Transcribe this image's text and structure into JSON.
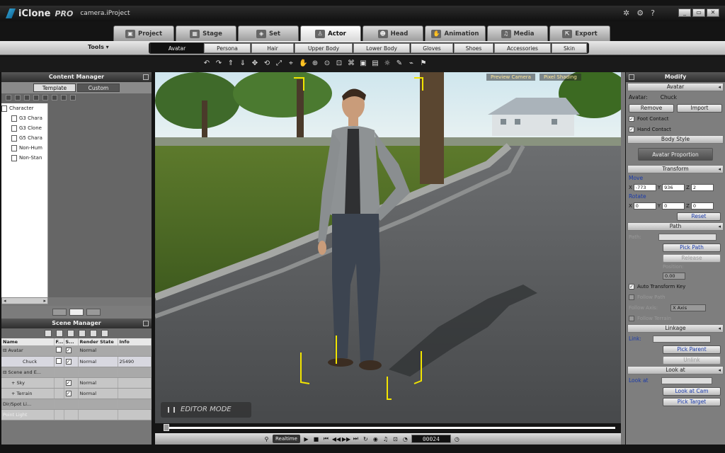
{
  "app": {
    "brand": "iClone",
    "edition": "PRO",
    "project": "camera.iProject"
  },
  "window_controls": [
    "_",
    "▭",
    "✕"
  ],
  "title_icons": {
    "puzzle": "✲",
    "gear": "⚙",
    "help": "?"
  },
  "main_tabs": [
    {
      "label": "Project",
      "icon": "▣"
    },
    {
      "label": "Stage",
      "icon": "▦"
    },
    {
      "label": "Set",
      "icon": "◈"
    },
    {
      "label": "Actor",
      "icon": "♙"
    },
    {
      "label": "Head",
      "icon": "☻"
    },
    {
      "label": "Animation",
      "icon": "✋"
    },
    {
      "label": "Media",
      "icon": "♫"
    },
    {
      "label": "Export",
      "icon": "⇱"
    }
  ],
  "active_main_tab": "Actor",
  "tools_label": "Tools ▾",
  "sub_tabs": [
    "Avatar",
    "Persona",
    "Hair",
    "Upper Body",
    "Lower Body",
    "Gloves",
    "Shoes",
    "Accessories",
    "Skin"
  ],
  "active_sub_tab": "Avatar",
  "content_manager": {
    "title": "Content Manager",
    "tabs": [
      "Template",
      "Custom"
    ],
    "active_tab": "Template",
    "tree": [
      "Character",
      "G3 Chara",
      "G3 Clone",
      "G5 Chara",
      "Non-Hum",
      "Non-Stan"
    ],
    "scroll_left": "◂",
    "scroll_right": "▸"
  },
  "scene_manager": {
    "title": "Scene Manager",
    "columns": [
      "Name",
      "F...",
      "S...",
      "Render State",
      "Info"
    ],
    "rows": [
      {
        "name": "⊟ Avatar",
        "render": "Normal",
        "info": "",
        "show": "✓"
      },
      {
        "name": "Chuck",
        "render": "Normal",
        "info": "25490",
        "show": "✓"
      },
      {
        "name": "⊟ Scene and E...",
        "render": "",
        "info": "",
        "show": ""
      },
      {
        "name": "+ Sky",
        "render": "Normal",
        "info": "",
        "show": "✓"
      },
      {
        "name": "+ Terrain",
        "render": "Normal",
        "info": "",
        "show": "✓"
      },
      {
        "name": "Dir/Spot Li...",
        "render": "",
        "info": "",
        "show": ""
      },
      {
        "name": "Point Light",
        "render": "",
        "info": "",
        "show": ""
      }
    ]
  },
  "viewport": {
    "preview_camera": "Preview Camera",
    "pixel_shading": "Pixel Shading",
    "mode": "EDITOR MODE",
    "frame": "00024",
    "realtime": "Realtime"
  },
  "modify": {
    "title": "Modify",
    "avatar_section": "Avatar",
    "avatar_label": "Avatar:",
    "avatar_name": "Chuck",
    "remove": "Remove",
    "import": "Import",
    "foot_contact": "Foot Contact",
    "hand_contact": "Hand Contact",
    "body_style": "Body Style",
    "avatar_proportion": "Avatar Proportion",
    "transform": "Transform",
    "move_label": "Move",
    "move": {
      "x": "-773",
      "y": "936",
      "z": "2"
    },
    "rotate_label": "Rotate",
    "rotate": {
      "x": "0",
      "y": "0",
      "z": "0"
    },
    "reset": "Reset",
    "path_section": "Path",
    "path_label": "Path:",
    "pick_path": "Pick Path",
    "release": "Release",
    "position_label": "Position:",
    "position_value": "0.00",
    "auto_transform": "Auto Transform Key",
    "follow_path": "Follow Path",
    "follow_axis": "Follow Axis:",
    "follow_axis_value": "X Axis",
    "follow_terrain": "Follow Terrain",
    "linkage": "Linkage",
    "link_label": "Link:",
    "pick_parent": "Pick Parent",
    "unlink": "Unlink",
    "look_at_section": "Look at",
    "look_at_label": "Look at",
    "look_at_cam": "Look at Cam",
    "pick_target": "Pick Target"
  }
}
